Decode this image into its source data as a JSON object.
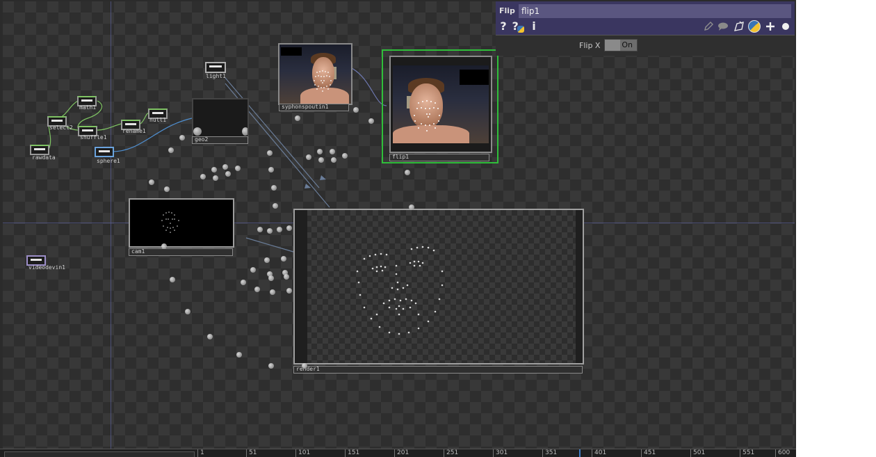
{
  "network": {
    "nodes": {
      "light1": "light1",
      "math1": "math1",
      "select2": "select2",
      "shuffle1": "shuffle1",
      "rename1": "rename1",
      "null1": "null1",
      "rawdata": "rawdata",
      "sphere1": "sphere1",
      "geo2": "geo2",
      "syphonspoutin1": "syphonspoutin1",
      "flip1": "flip1",
      "cam1": "cam1",
      "videodevin1": "videodevin1",
      "render1": "render1"
    }
  },
  "params": {
    "op_type": "Flip",
    "op_name": "flip1",
    "icons": [
      "help-icon",
      "python-help-icon",
      "info-icon",
      "edit-icon",
      "comment-icon",
      "node-clone-icon",
      "python-icon",
      "add-icon",
      "dot-icon"
    ],
    "help_glyph": "?",
    "python_help_glyph": "?",
    "info_glyph": "i",
    "flip_x_label": "Flip X",
    "flip_x_value": "On"
  },
  "timeline": {
    "ticks": [
      "1",
      "51",
      "101",
      "151",
      "201",
      "251",
      "301",
      "351",
      "401",
      "451",
      "501",
      "551",
      "600"
    ]
  },
  "colors": {
    "selected_border": "#2fbf3a",
    "param_header": "#3a3660",
    "playhead": "#3f7cc6"
  }
}
